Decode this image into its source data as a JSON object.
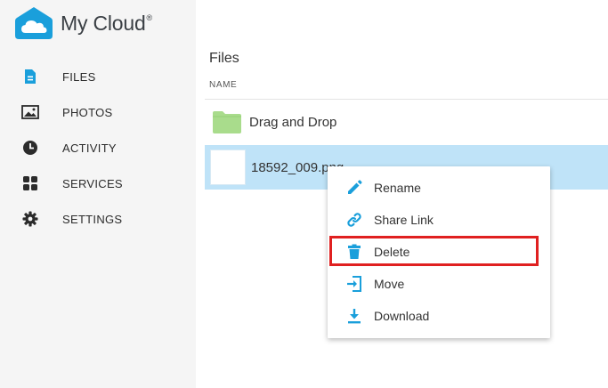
{
  "brand": {
    "name": "My Cloud",
    "mark": "®",
    "color": "#1a9fdb"
  },
  "sidebar": {
    "items": [
      {
        "label": "FILES",
        "icon": "file-icon"
      },
      {
        "label": "PHOTOS",
        "icon": "photo-icon"
      },
      {
        "label": "ACTIVITY",
        "icon": "clock-icon"
      },
      {
        "label": "SERVICES",
        "icon": "grid-icon"
      },
      {
        "label": "SETTINGS",
        "icon": "gear-icon"
      }
    ]
  },
  "main": {
    "title": "Files",
    "column_header": "NAME",
    "rows": [
      {
        "name": "Drag and Drop",
        "type": "folder",
        "icon": "folder-icon"
      },
      {
        "name": "18592_009.png",
        "type": "file",
        "selected": true,
        "icon": "image-thumbnail"
      }
    ]
  },
  "context_menu": {
    "items": [
      {
        "label": "Rename",
        "icon": "pencil-icon"
      },
      {
        "label": "Share Link",
        "icon": "link-icon"
      },
      {
        "label": "Delete",
        "icon": "trash-icon",
        "highlighted": true
      },
      {
        "label": "Move",
        "icon": "move-icon"
      },
      {
        "label": "Download",
        "icon": "download-icon"
      }
    ]
  },
  "colors": {
    "accent": "#1a9fdb",
    "selection": "#bfe3f8",
    "highlight_border": "#e02020",
    "folder": "#a9dc8c"
  }
}
